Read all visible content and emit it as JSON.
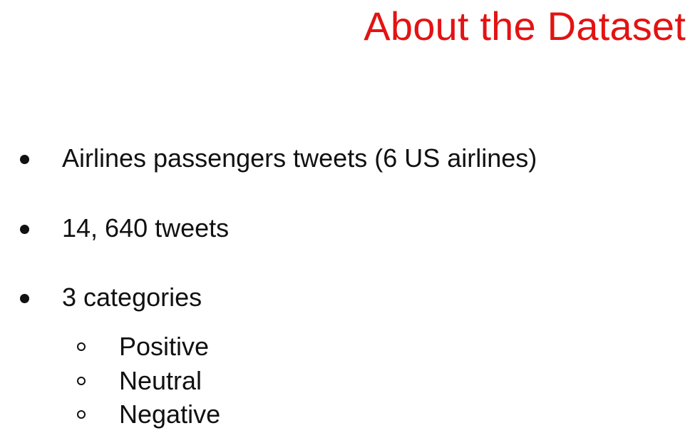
{
  "slide": {
    "title": "About the Dataset",
    "title_color": "#e31313",
    "bullets": [
      {
        "text": "Airlines passengers tweets (6 US airlines)"
      },
      {
        "text": "14, 640 tweets"
      },
      {
        "text": "3 categories"
      }
    ],
    "sub_bullets": [
      {
        "text": "Positive"
      },
      {
        "text": "Neutral"
      },
      {
        "text": "Negative"
      }
    ]
  }
}
